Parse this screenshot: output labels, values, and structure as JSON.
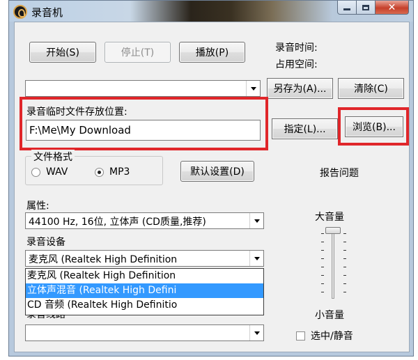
{
  "window": {
    "title": "录音机",
    "close_glyph": "✕"
  },
  "controls": {
    "start": "开始(S)",
    "stop": "停止(T)",
    "play": "播放(P)",
    "record_time_label": "录音时间:",
    "space_label": "占用空间:",
    "save_as": "另存为(A)...",
    "clear": "清除(C)",
    "specify": "指定(L)...",
    "browse": "浏览(B)...",
    "default_settings": "默认设置(D)",
    "report_issue": "报告问题"
  },
  "temp_path": {
    "label": "录音临时文件存放位置:",
    "value": "F:\\Me\\My Download"
  },
  "format": {
    "label": "文件格式",
    "options": [
      "WAV",
      "MP3"
    ],
    "selected": "MP3"
  },
  "properties": {
    "label": "属性:",
    "value": "44100 Hz, 16位, 立体声 (CD质量,推荐)"
  },
  "device": {
    "label": "录音设备",
    "value": "麦克风 (Realtek High Definition",
    "options": [
      "麦克风 (Realtek High Definition",
      "立体声混音 (Realtek High Defini",
      "CD 音频 (Realtek High Definitio"
    ],
    "highlighted_index": 1
  },
  "line": {
    "label": "录音线路",
    "value": ""
  },
  "volume": {
    "max_label": "大音量",
    "min_label": "小音量",
    "mute_label": "选中/静音",
    "mute_checked": false
  },
  "colors": {
    "highlight_box": "#e0262a",
    "selection": "#3399ff"
  }
}
